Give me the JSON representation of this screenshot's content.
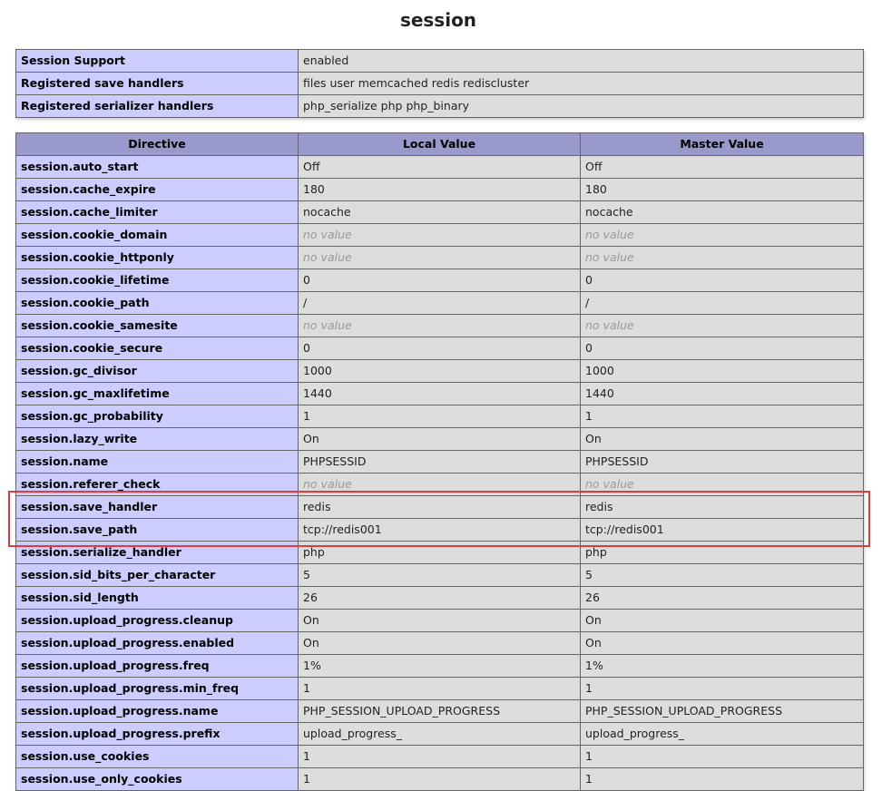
{
  "page_title": "session",
  "support": [
    {
      "label": "Session Support",
      "value": "enabled"
    },
    {
      "label": "Registered save handlers",
      "value": "files user memcached redis rediscluster"
    },
    {
      "label": "Registered serializer handlers",
      "value": "php_serialize php php_binary"
    }
  ],
  "headers": {
    "directive": "Directive",
    "local": "Local Value",
    "master": "Master Value"
  },
  "rows": [
    {
      "directive": "session.auto_start",
      "local": "Off",
      "master": "Off"
    },
    {
      "directive": "session.cache_expire",
      "local": "180",
      "master": "180"
    },
    {
      "directive": "session.cache_limiter",
      "local": "nocache",
      "master": "nocache"
    },
    {
      "directive": "session.cookie_domain",
      "local": "no value",
      "master": "no value",
      "novalue": true
    },
    {
      "directive": "session.cookie_httponly",
      "local": "no value",
      "master": "no value",
      "novalue": true
    },
    {
      "directive": "session.cookie_lifetime",
      "local": "0",
      "master": "0"
    },
    {
      "directive": "session.cookie_path",
      "local": "/",
      "master": "/"
    },
    {
      "directive": "session.cookie_samesite",
      "local": "no value",
      "master": "no value",
      "novalue": true
    },
    {
      "directive": "session.cookie_secure",
      "local": "0",
      "master": "0"
    },
    {
      "directive": "session.gc_divisor",
      "local": "1000",
      "master": "1000"
    },
    {
      "directive": "session.gc_maxlifetime",
      "local": "1440",
      "master": "1440"
    },
    {
      "directive": "session.gc_probability",
      "local": "1",
      "master": "1"
    },
    {
      "directive": "session.lazy_write",
      "local": "On",
      "master": "On"
    },
    {
      "directive": "session.name",
      "local": "PHPSESSID",
      "master": "PHPSESSID"
    },
    {
      "directive": "session.referer_check",
      "local": "no value",
      "master": "no value",
      "novalue": true
    },
    {
      "directive": "session.save_handler",
      "local": "redis",
      "master": "redis"
    },
    {
      "directive": "session.save_path",
      "local": "tcp://redis001",
      "master": "tcp://redis001"
    },
    {
      "directive": "session.serialize_handler",
      "local": "php",
      "master": "php"
    },
    {
      "directive": "session.sid_bits_per_character",
      "local": "5",
      "master": "5"
    },
    {
      "directive": "session.sid_length",
      "local": "26",
      "master": "26"
    },
    {
      "directive": "session.upload_progress.cleanup",
      "local": "On",
      "master": "On"
    },
    {
      "directive": "session.upload_progress.enabled",
      "local": "On",
      "master": "On"
    },
    {
      "directive": "session.upload_progress.freq",
      "local": "1%",
      "master": "1%"
    },
    {
      "directive": "session.upload_progress.min_freq",
      "local": "1",
      "master": "1"
    },
    {
      "directive": "session.upload_progress.name",
      "local": "PHP_SESSION_UPLOAD_PROGRESS",
      "master": "PHP_SESSION_UPLOAD_PROGRESS"
    },
    {
      "directive": "session.upload_progress.prefix",
      "local": "upload_progress_",
      "master": "upload_progress_"
    },
    {
      "directive": "session.use_cookies",
      "local": "1",
      "master": "1"
    },
    {
      "directive": "session.use_only_cookies",
      "local": "1",
      "master": "1"
    }
  ],
  "colors": {
    "highlight": "#e03a3a",
    "header": "#9999cc",
    "label": "#ccccff",
    "value": "#dddddd"
  }
}
